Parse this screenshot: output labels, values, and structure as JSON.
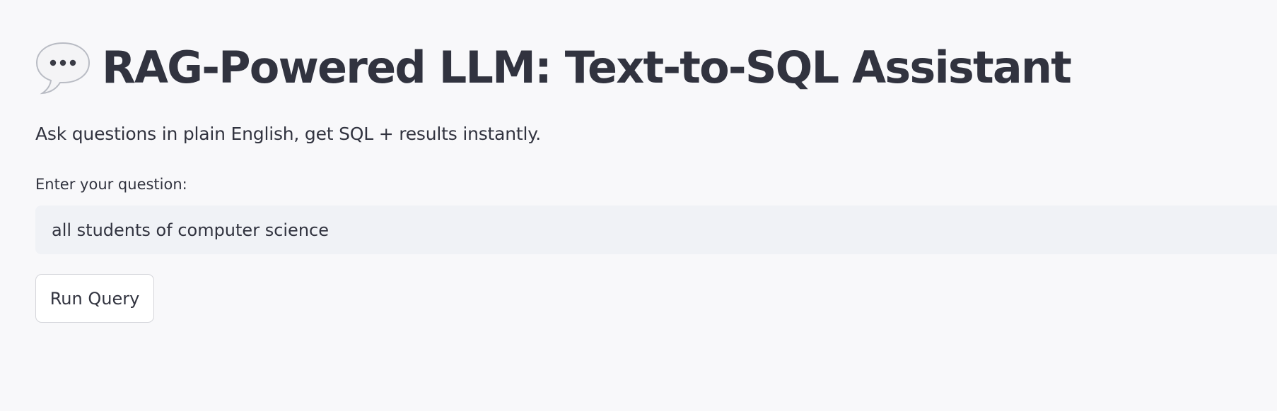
{
  "header": {
    "icon": "speech-bubble-icon",
    "title": "RAG-Powered LLM: Text-to-SQL Assistant"
  },
  "subtitle": "Ask questions in plain English, get SQL + results instantly.",
  "question_field": {
    "label": "Enter your question:",
    "value": "all students of computer science"
  },
  "run_button": {
    "label": "Run Query"
  },
  "colors": {
    "text": "#31333f",
    "input_background": "#f0f2f6",
    "page_background": "#f8f8fa",
    "button_border": "#d4d5da"
  }
}
